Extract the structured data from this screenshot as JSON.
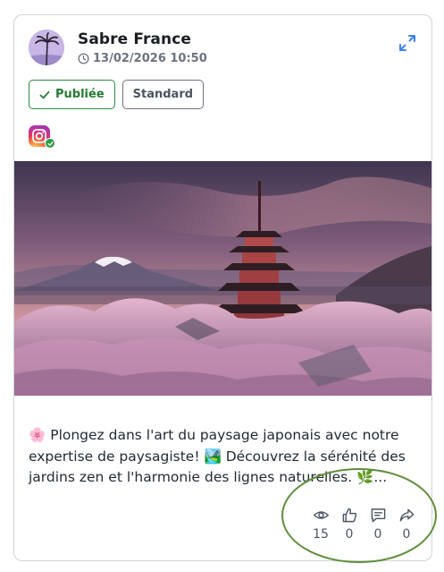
{
  "post": {
    "author": "Sabre France",
    "datetime": "13/02/2026 10:50",
    "status_label": "Publiée",
    "type_label": "Standard",
    "platform_icon": "instagram-icon",
    "caption": "🌸 Plongez dans l'art du paysage japonais avec notre expertise de paysagiste! 🏞️ Découvrez la sérénité des jardins zen et l'harmonie des lignes naturelles. 🌿...",
    "media_description_icon": "photo-icon"
  },
  "stats": {
    "views": "15",
    "likes": "0",
    "comments": "0",
    "shares": "0"
  },
  "colors": {
    "status_green": "#2e8b3e",
    "accent_blue": "#3b82f6",
    "highlight_ring": "#5f8f3a"
  }
}
